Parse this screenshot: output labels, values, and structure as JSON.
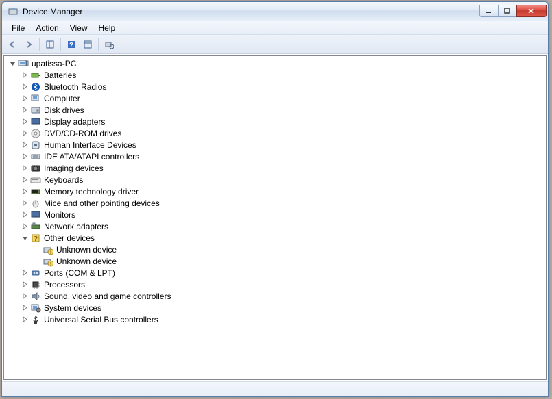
{
  "window": {
    "title": "Device Manager"
  },
  "menu": {
    "file": "File",
    "action": "Action",
    "view": "View",
    "help": "Help"
  },
  "tree": {
    "root": {
      "label": "upatissa-PC",
      "expanded": true
    },
    "items": [
      {
        "label": "Batteries",
        "icon": "battery"
      },
      {
        "label": "Bluetooth Radios",
        "icon": "bluetooth"
      },
      {
        "label": "Computer",
        "icon": "computer"
      },
      {
        "label": "Disk drives",
        "icon": "disk"
      },
      {
        "label": "Display adapters",
        "icon": "display"
      },
      {
        "label": "DVD/CD-ROM drives",
        "icon": "dvd"
      },
      {
        "label": "Human Interface Devices",
        "icon": "hid"
      },
      {
        "label": "IDE ATA/ATAPI controllers",
        "icon": "ide"
      },
      {
        "label": "Imaging devices",
        "icon": "imaging"
      },
      {
        "label": "Keyboards",
        "icon": "keyboard"
      },
      {
        "label": "Memory technology driver",
        "icon": "memory"
      },
      {
        "label": "Mice and other pointing devices",
        "icon": "mouse"
      },
      {
        "label": "Monitors",
        "icon": "monitor"
      },
      {
        "label": "Network adapters",
        "icon": "network"
      },
      {
        "label": "Other devices",
        "icon": "other",
        "expanded": true,
        "children": [
          {
            "label": "Unknown device",
            "icon": "unknown"
          },
          {
            "label": "Unknown device",
            "icon": "unknown"
          }
        ]
      },
      {
        "label": "Ports (COM & LPT)",
        "icon": "ports"
      },
      {
        "label": "Processors",
        "icon": "processor"
      },
      {
        "label": "Sound, video and game controllers",
        "icon": "sound"
      },
      {
        "label": "System devices",
        "icon": "system"
      },
      {
        "label": "Universal Serial Bus controllers",
        "icon": "usb"
      }
    ]
  }
}
